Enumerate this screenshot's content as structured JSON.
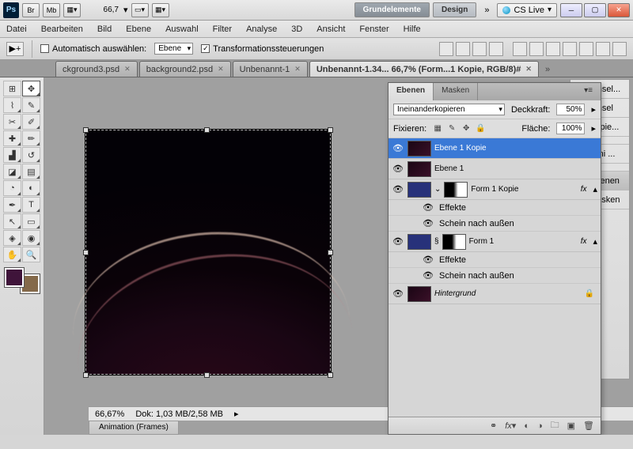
{
  "app": {
    "logo": "Ps",
    "zoom_top": "66,7"
  },
  "top_buttons": [
    "Br",
    "Mb"
  ],
  "workspace": {
    "active": "Grundelemente",
    "other": "Design",
    "more": "»"
  },
  "cslive": "CS Live",
  "menus": [
    "Datei",
    "Bearbeiten",
    "Bild",
    "Ebene",
    "Auswahl",
    "Filter",
    "Analyse",
    "3D",
    "Ansicht",
    "Fenster",
    "Hilfe"
  ],
  "options": {
    "auto_select_label": "Automatisch auswählen:",
    "auto_select_value": "Ebene",
    "transform_label": "Transformationssteuerungen"
  },
  "doc_tabs": [
    {
      "label": "ckground3.psd"
    },
    {
      "label": "background2.psd"
    },
    {
      "label": "Unbenannt-1"
    },
    {
      "label": "Unbenannt-1.34...  66,7% (Form...1 Kopie, RGB/8)#"
    }
  ],
  "status": {
    "zoom": "66,67%",
    "dok_label": "Dok:",
    "dok": "1,03 MB/2,58 MB"
  },
  "anim_tab": "Animation (Frames)",
  "right_buttons": [
    "Pinsel...",
    "Pinsel",
    "Kopie...",
    "Mini ...",
    "Ebenen",
    "Masken"
  ],
  "layers_panel": {
    "tabs": [
      "Ebenen",
      "Masken"
    ],
    "blend": "Ineinanderkopieren",
    "opacity_label": "Deckkraft:",
    "opacity": "50%",
    "lock_label": "Fixieren:",
    "fill_label": "Fläche:",
    "fill": "100%",
    "items": [
      {
        "name": "Ebene 1 Kopie"
      },
      {
        "name": "Ebene 1"
      },
      {
        "name": "Form 1 Kopie"
      },
      {
        "effects_label": "Effekte"
      },
      {
        "glow_label": "Schein nach außen"
      },
      {
        "name": "Form 1"
      },
      {
        "name": "Hintergrund"
      }
    ]
  }
}
